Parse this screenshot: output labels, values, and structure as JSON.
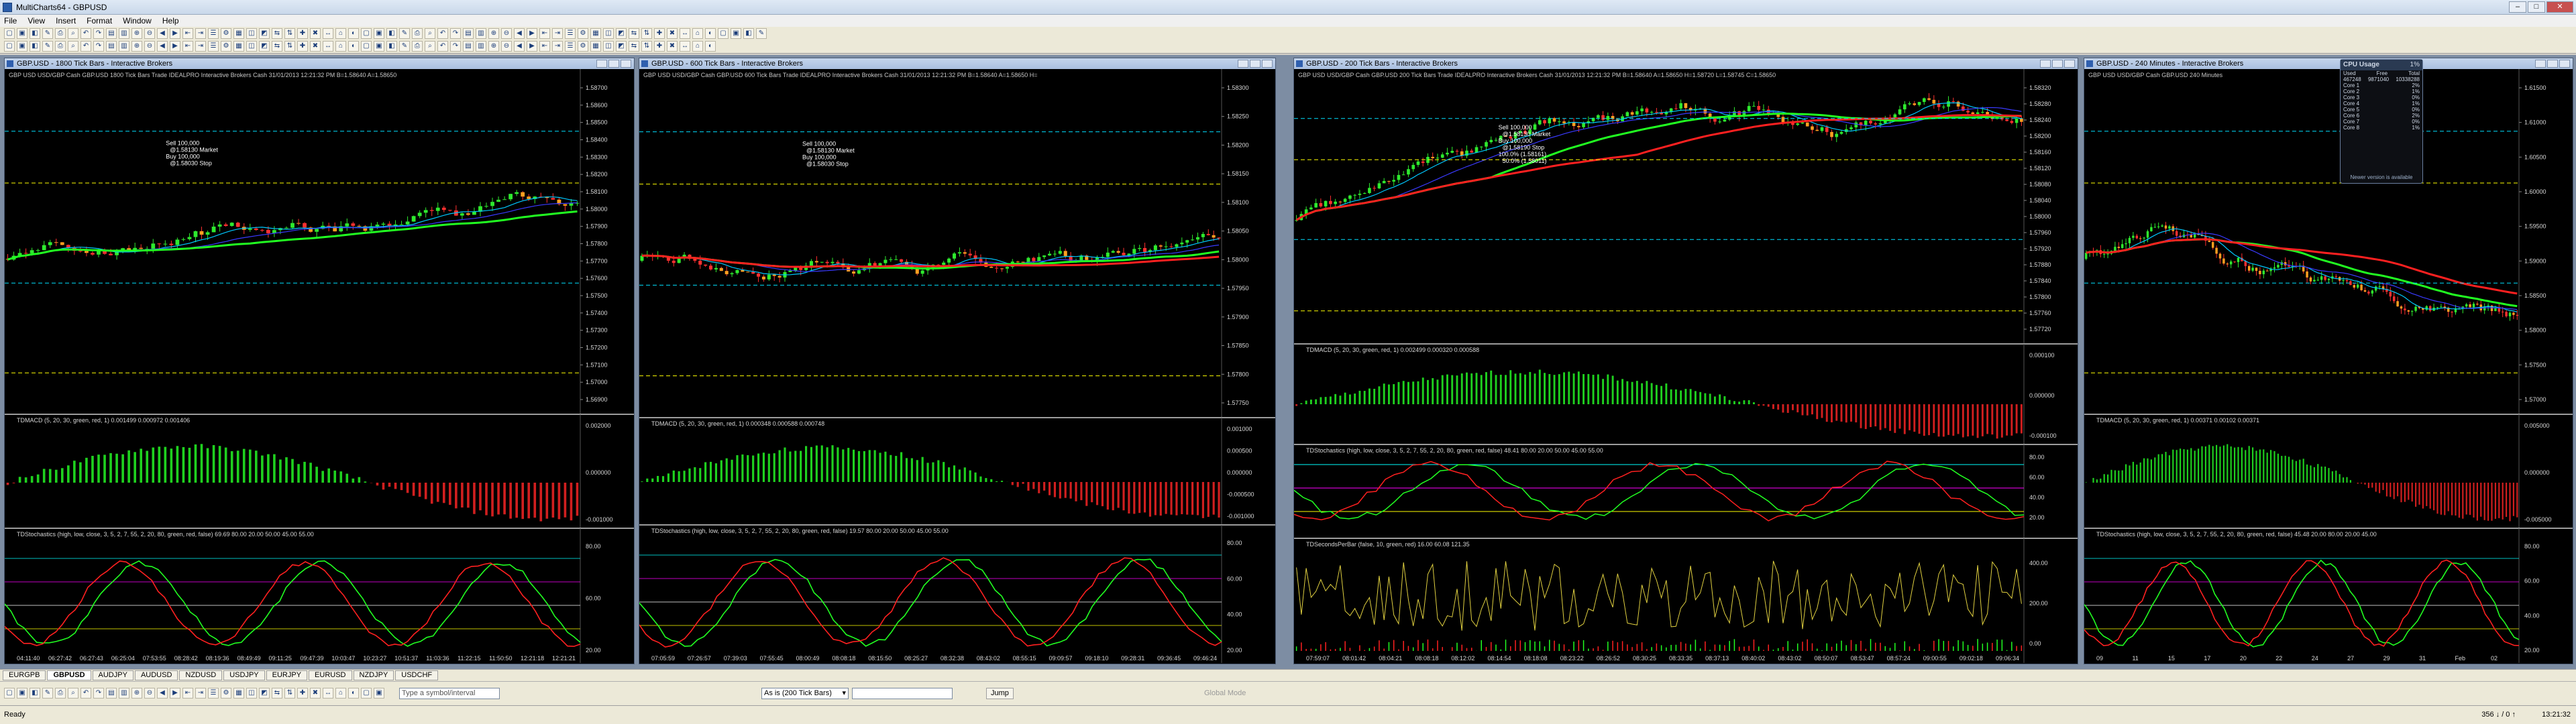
{
  "window": {
    "title": "MultiCharts64 - GBPUSD"
  },
  "menu": [
    "File",
    "View",
    "Insert",
    "Format",
    "Window",
    "Help"
  ],
  "charts": [
    {
      "title": "GBP.USD - 1800 Tick Bars - Interactive Brokers",
      "info": "GBP USD  USD/GBP Cash GBP.USD  1800 Tick Bars  Trade  IDEALPRO  Interactive Brokers  Cash  31/01/2013  12:21:32 PM  B=1.58640  A=1.58650",
      "price_labels": [
        "1.58700",
        "1.58600",
        "1.58500",
        "1.58400",
        "1.58300",
        "1.58200",
        "1.58100",
        "1.58000",
        "1.57900",
        "1.57800",
        "1.57700",
        "1.57600",
        "1.57500",
        "1.57400",
        "1.57300",
        "1.57200",
        "1.57100",
        "1.57000",
        "1.56900"
      ],
      "annotations": [
        "Sell 100,000",
        "@1.58130 Market",
        "Buy 100,000",
        "@1.58030 Stop"
      ],
      "macd_label": "TDMACD (5, 20, 30, green, red, 1)  0.001499  0.000972  0.001406",
      "macd_scale": [
        "0.002000",
        "0.000000",
        "-0.001000"
      ],
      "stoch_label": "TDStochastics (high, low, close, 3, 5, 2, 7, 55, 2, 20, 80, green, red, false)  69.69  80.00  20.00  50.00  45.00  55.00",
      "stoch_scale": [
        "80.00",
        "60.00",
        "20.00"
      ],
      "time_labels": [
        "04:11:40",
        "06:27:42",
        "06:27:43",
        "06:25:04",
        "07:53:55",
        "08:28:42",
        "08:19:36",
        "08:49:49",
        "09:11:25",
        "09:47:39",
        "10:03:47",
        "10:23:27",
        "10:51:37",
        "11:03:36",
        "11:22:15",
        "11:50:50",
        "12:21:18",
        "12:21:21"
      ]
    },
    {
      "title": "GBP.USD - 600 Tick Bars - Interactive Brokers",
      "info": "GBP USD  USD/GBP Cash GBP.USD  600 Tick Bars  Trade  IDEALPRO  Interactive Brokers  Cash  31/01/2013  12:21:32 PM  B=1.58640  A=1.58650  H=",
      "price_labels": [
        "1.58300",
        "1.58250",
        "1.58200",
        "1.58150",
        "1.58100",
        "1.58050",
        "1.58000",
        "1.57950",
        "1.57900",
        "1.57850",
        "1.57800",
        "1.57750"
      ],
      "annotations": [
        "Sell 100,000",
        "@1.58130 Market",
        "Buy 100,000",
        "@1.58030 Stop"
      ],
      "macd_label": "TDMACD (5, 20, 30, green, red, 1)  0.000348  0.000588  0.000748",
      "macd_scale": [
        "0.001000",
        "0.000500",
        "0.000000",
        "-0.000500",
        "-0.001000"
      ],
      "stoch_label": "TDStochastics (high, low, close, 3, 5, 2, 7, 55, 2, 20, 80, green, red, false)  19.57  80.00  20.00  50.00  45.00  55.00",
      "stoch_scale": [
        "80.00",
        "60.00",
        "40.00",
        "20.00"
      ],
      "time_labels": [
        "07:05:59",
        "07:26:57",
        "07:39:03",
        "07:55:45",
        "08:00:49",
        "08:08:18",
        "08:15:50",
        "08:25:27",
        "08:32:38",
        "08:43:02",
        "08:55:15",
        "09:09:57",
        "09:18:10",
        "09:28:31",
        "09:36:45",
        "09:46:24"
      ]
    },
    {
      "title": "GBP.USD - 200 Tick Bars - Interactive Brokers",
      "info": "GBP USD  USD/GBP Cash GBP.USD  200 Tick Bars  Trade  IDEALPRO  Interactive Brokers  Cash  31/01/2013  12:21:32 PM  B=1.58640  A=1.58650  H=1.58720  L=1.58745  C=1.58650",
      "price_labels": [
        "1.58320",
        "1.58280",
        "1.58240",
        "1.58200",
        "1.58160",
        "1.58120",
        "1.58080",
        "1.58040",
        "1.58000",
        "1.57960",
        "1.57920",
        "1.57880",
        "1.57840",
        "1.57800",
        "1.57760",
        "1.57720"
      ],
      "annotations": [
        "Sell 100,000",
        "@1.58130 Market",
        "Buy 100,000",
        "@1.58190 Stop",
        "100.0% (1.58161)",
        "50.0% (1.58011)"
      ],
      "macd_label": "TDMACD (5, 20, 30, green, red, 1)  0.002499  0.000320  0.000588",
      "macd_scale": [
        "0.000100",
        "0.000000",
        "-0.000100"
      ],
      "stoch_label": "TDStochastics (high, low, close, 3, 5, 2, 7, 55, 2, 20, 80, green, red, false)  48.41  80.00  20.00  50.00  45.00  55.00",
      "stoch_scale": [
        "80.00",
        "60.00",
        "40.00",
        "20.00"
      ],
      "extra_label": "TDSecondsPerBar (false, 10, green, red)  16.00  60.08  121.35",
      "extra_scale": [
        "400.00",
        "200.00",
        "0.00"
      ],
      "time_labels": [
        "07:59:07",
        "08:01:42",
        "08:04:21",
        "08:08:18",
        "08:12:02",
        "08:14:54",
        "08:18:08",
        "08:23:22",
        "08:26:52",
        "08:30:25",
        "08:33:35",
        "08:37:13",
        "08:40:02",
        "08:43:02",
        "08:50:07",
        "08:53:47",
        "08:57:24",
        "09:00:55",
        "09:02:18",
        "09:06:34"
      ]
    },
    {
      "title": "GBP.USD - 240 Minutes - Interactive Brokers",
      "info": "GBP USD  USD/GBP Cash GBP.USD  240 Minutes",
      "price_labels": [
        "1.61500",
        "1.61000",
        "1.60500",
        "1.60000",
        "1.59500",
        "1.59000",
        "1.58500",
        "1.58000",
        "1.57500",
        "1.57000"
      ],
      "annotations": [],
      "macd_label": "TDMACD (5, 20, 30, green, red, 1)  0.00371  0.00102  0.00371",
      "macd_scale": [
        "0.005000",
        "0.000000",
        "-0.005000"
      ],
      "stoch_label": "TDStochastics (high, low, close, 3, 5, 2, 7, 55, 2, 20, 80, green, red, false)  45.48  20.00  80.00  20.00  45.00",
      "stoch_scale": [
        "80.00",
        "60.00",
        "40.00",
        "20.00"
      ],
      "time_labels": [
        "09",
        "11",
        "15",
        "17",
        "20",
        "22",
        "24",
        "27",
        "29",
        "31",
        "Feb",
        "02"
      ]
    }
  ],
  "tabs": [
    "EURGPB",
    "GBPUSD",
    "AUDJPY",
    "AUDUSD",
    "NZDUSD",
    "USDJPY",
    "EURJPY",
    "EURUSD",
    "NZDJPY",
    "USDCHF"
  ],
  "active_tab": "GBPUSD",
  "drawbar": {
    "symbol_placeholder": "Type a symbol/interval",
    "interval": "As is (200 Tick Bars)",
    "jump_label": "Jump",
    "global_mode": "Global Mode"
  },
  "status": {
    "ready": "Ready",
    "net": "356 ↓ / 0 ↑",
    "clock": "13:21:32"
  },
  "cpu": {
    "title": "CPU Usage",
    "percent": "1%",
    "rows": [
      [
        "Used",
        "Free",
        "Total"
      ],
      [
        "467248",
        "9871040",
        "10338288"
      ],
      [
        "Core 1",
        "",
        "2%"
      ],
      [
        "Core 2",
        "",
        "1%"
      ],
      [
        "Core 3",
        "",
        "0%"
      ],
      [
        "Core 4",
        "",
        "1%"
      ],
      [
        "Core 5",
        "",
        "0%"
      ],
      [
        "Core 6",
        "",
        "2%"
      ],
      [
        "Core 7",
        "",
        "0%"
      ],
      [
        "Core 8",
        "",
        "1%"
      ]
    ],
    "note": "Newer version is available"
  }
}
